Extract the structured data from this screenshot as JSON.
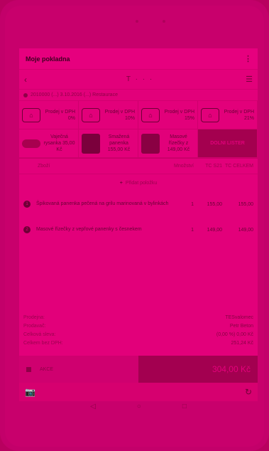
{
  "app": {
    "title": "Moje pokladna",
    "menu_icon": "more-vert-icon"
  },
  "topbar": {
    "back_icon": "back-arrow-icon",
    "logo": "T · · ·",
    "menu_icon": "hamburger-icon"
  },
  "status": {
    "text": "2010000 (...) 3.10.2016 (...) Restaurace"
  },
  "quick_tiles": [
    {
      "label": "Prodej v DPH 0%",
      "icon": "register-icon"
    },
    {
      "label": "Prodej v DPH 10%",
      "icon": "register-icon"
    },
    {
      "label": "Prodej v DPH 15%",
      "icon": "register-icon"
    },
    {
      "label": "Prodej v DPH 21%",
      "icon": "register-icon"
    }
  ],
  "products": [
    {
      "label": "Vaječná rysanka 35,00 Kč"
    },
    {
      "label": "Smažená panenka 155,00 Kč"
    },
    {
      "label": "Masové řízečky z 149,00 Kč"
    }
  ],
  "more_button": "DOLNI LISTER",
  "table": {
    "headers": {
      "name": "Zboží",
      "qty": "Množství",
      "price": "TC S21",
      "total": "TC CELKEM"
    },
    "add_note": "Přidat položku",
    "rows": [
      {
        "num": "1",
        "name": "Špikovaná panenka pečená na grilu marinovaná v bylinkách",
        "qty": "1",
        "price": "155,00",
        "total": "155,00"
      },
      {
        "num": "2",
        "name": "Masové řízečky z vepřové panenky s česnekem",
        "qty": "1",
        "price": "149,00",
        "total": "149,00"
      }
    ]
  },
  "summary": [
    {
      "label": "Prodejna:",
      "value": "TESvalomec"
    },
    {
      "label": "Prodavač:",
      "value": "Petr Beton"
    },
    {
      "label": "Celková sleva:",
      "value": "(0,00 %) 0,00 Kč"
    },
    {
      "label": "Celkem bez DPH:",
      "value": "251,24 Kč"
    }
  ],
  "paybar": {
    "akce": "AKCE",
    "total": "304,00 Kč"
  },
  "footer": {
    "left_icon": "camera-icon",
    "right_icon": "refresh-icon"
  },
  "navbar": {
    "back": "◁",
    "home": "○",
    "recent": "□"
  }
}
